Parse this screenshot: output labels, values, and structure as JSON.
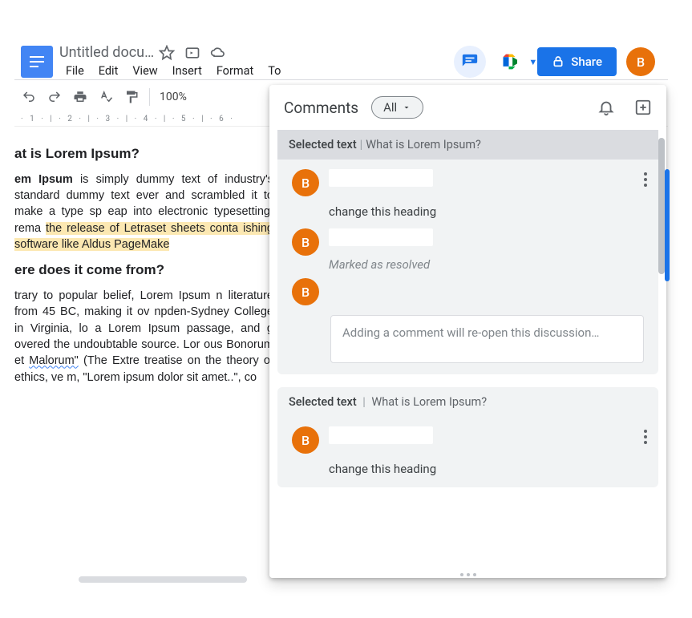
{
  "doc": {
    "title": "Untitled docu…",
    "menus": {
      "file": "File",
      "edit": "Edit",
      "view": "View",
      "insert": "Insert",
      "format": "Format",
      "tools": "To"
    },
    "zoom": "100%",
    "share": "Share",
    "avatar_initial": "B",
    "ruler": " · 1 · | · 2 · | · 3 · | · 4 · | · 5 · | · 6 ·"
  },
  "body": {
    "h1": "at is Lorem Ipsum?",
    "p1a": "em Ipsum",
    "p1b": " is simply dummy text of industry's standard dummy text ever  and scrambled it to make a type sp eap into electronic typesetting, rema ",
    "p1h": "the release of Letraset sheets conta",
    "p1c": " ishing software like Aldus PageMake",
    "h2": "ere does it come from?",
    "p2a": "trary to popular belief, Lorem Ipsum n literature from 45 BC, making it ov npden-Sydney College in Virginia, lo  a Lorem Ipsum passage, and g overed the undoubtable source. Lor ous Bonorum et ",
    "p2m": "Malorum\"",
    "p2b": " (The Extre  treatise on the theory of ethics, ve m, \"Lorem ipsum dolor sit amet..\", co"
  },
  "panel": {
    "title": "Comments",
    "filter": "All",
    "threads": [
      {
        "selected_label": "Selected text",
        "selected_text": "What is Lorem Ipsum?",
        "items": [
          {
            "avatar": "B",
            "text": "change this heading"
          },
          {
            "avatar": "B",
            "resolved": "Marked as resolved"
          }
        ],
        "reply_avatar": "B",
        "reply_placeholder": "Adding a comment will re-open this discussion…"
      },
      {
        "selected_label": "Selected text",
        "selected_text": "What is Lorem Ipsum?",
        "items": [
          {
            "avatar": "B",
            "text": "change this heading"
          }
        ]
      }
    ]
  }
}
